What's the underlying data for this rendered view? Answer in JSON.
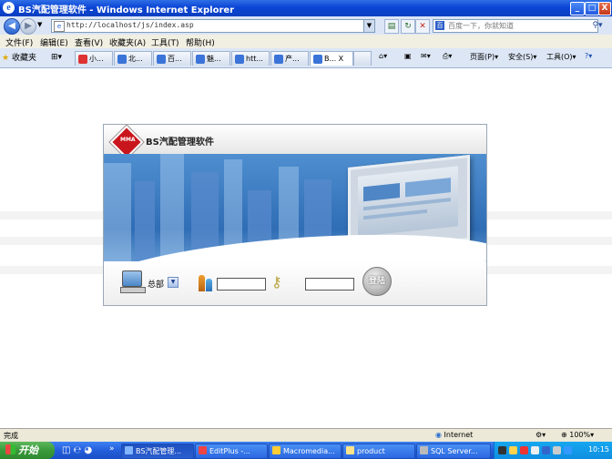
{
  "window": {
    "title": "BS汽配管理软件 - Windows Internet Explorer",
    "minimize": "_",
    "maximize": "□",
    "close": "X"
  },
  "address_bar": {
    "url": "http://localhost/js/index.asp",
    "search_placeholder": "百度一下，你就知道"
  },
  "menu": [
    "文件(F)",
    "编辑(E)",
    "查看(V)",
    "收藏夹(A)",
    "工具(T)",
    "帮助(H)"
  ],
  "tabs": {
    "favorites_label": "收藏夹",
    "items": [
      "小...",
      "北...",
      "百...",
      "魅...",
      "htt...",
      "产...",
      "B..."
    ],
    "active_close": "X"
  },
  "command_bar": {
    "page": "页面(P)",
    "safety": "安全(S)",
    "tools": "工具(O)"
  },
  "login_panel": {
    "logo_text": "MMA",
    "title": "BS汽配管理软件",
    "branch_value": "总部",
    "login_button": "登陆"
  },
  "status_bar": {
    "status": "完成",
    "zone": "Internet",
    "zoom": "100%"
  },
  "taskbar": {
    "start": "开始",
    "items": [
      "BS汽配管理...",
      "EditPlus -...",
      "Macromedia...",
      "product",
      "SQL Server..."
    ],
    "time": "10:15"
  },
  "colors": {
    "title_blue": "#0b45d6",
    "banner_blue": "#2f6db5",
    "logo_red": "#c9161c",
    "taskbar_blue": "#245edb"
  }
}
